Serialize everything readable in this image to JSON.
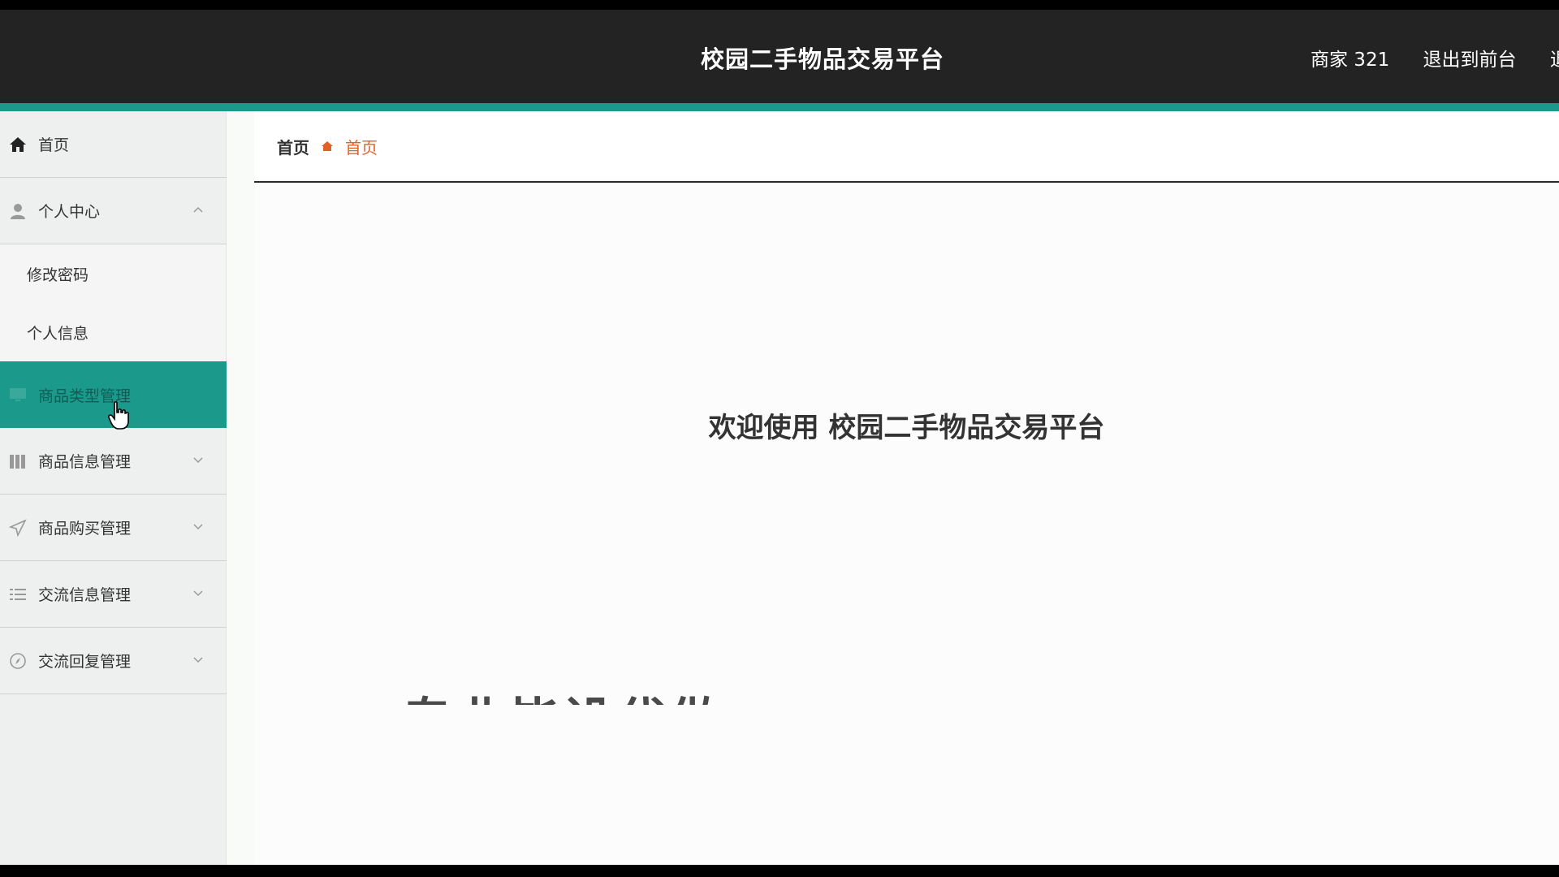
{
  "header": {
    "title": "校园二手物品交易平台",
    "user": "商家 321",
    "to_front": "退出到前台",
    "logout": "退"
  },
  "sidebar": {
    "home": "首页",
    "personal_center": "个人中心",
    "personal_sub": [
      "修改密码",
      "个人信息"
    ],
    "items": [
      {
        "label": "商品类型管理",
        "icon": "monitor-icon"
      },
      {
        "label": "商品信息管理",
        "icon": "book-icon"
      },
      {
        "label": "商品购买管理",
        "icon": "send-icon"
      },
      {
        "label": "交流信息管理",
        "icon": "list-icon"
      },
      {
        "label": "交流回复管理",
        "icon": "compass-icon"
      }
    ]
  },
  "breadcrumb": {
    "root": "首页",
    "current": "首页"
  },
  "main": {
    "welcome": "欢迎使用 校园二手物品交易平台",
    "overlay_text": "专业毕设代做"
  },
  "colors": {
    "header_bg": "#232323",
    "accent": "#1b9a8c",
    "breadcrumb_current": "#e0622a"
  }
}
